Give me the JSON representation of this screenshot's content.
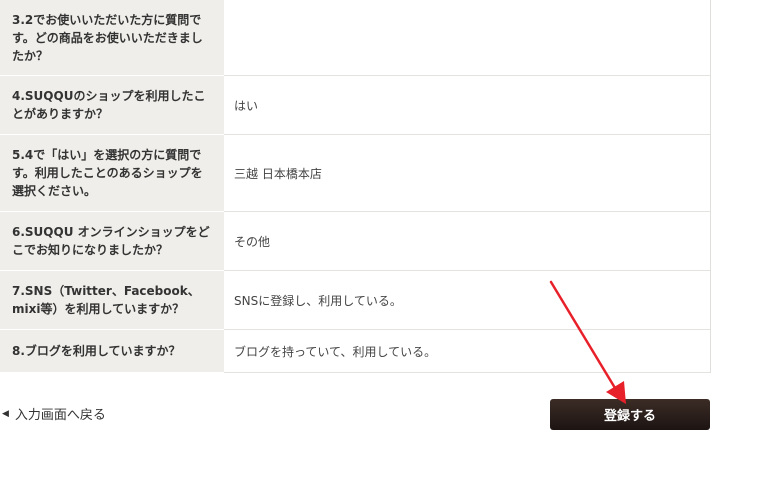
{
  "questions": [
    {
      "question": "3.2でお使いいただいた方に質問です。どの商品をお使いいただきましたか？",
      "answer": ""
    },
    {
      "question": "4.SUQQUのショップを利用したことがありますか？",
      "answer": "はい"
    },
    {
      "question": "5.4で「はい」を選択の方に質問です。利用したことのあるショップを選択ください。",
      "answer": "三越 日本橋本店"
    },
    {
      "question": "6.SUQQU オンラインショップをどこでお知りになりましたか？",
      "answer": "その他"
    },
    {
      "question": "7.SNS（Twitter、Facebook、mixi等）を利用していますか？",
      "answer": "SNSに登録し、利用している。"
    },
    {
      "question": "8.ブログを利用していますか？",
      "answer": "ブログを持っていて、利用している。"
    }
  ],
  "back_link": {
    "icon": "triangle-left-icon",
    "label": "入力画面へ戻る"
  },
  "submit_button": {
    "label": "登録する",
    "color": "#2b1f1b"
  },
  "annotation": {
    "icon": "red-arrow-icon",
    "color": "#e8202a"
  }
}
